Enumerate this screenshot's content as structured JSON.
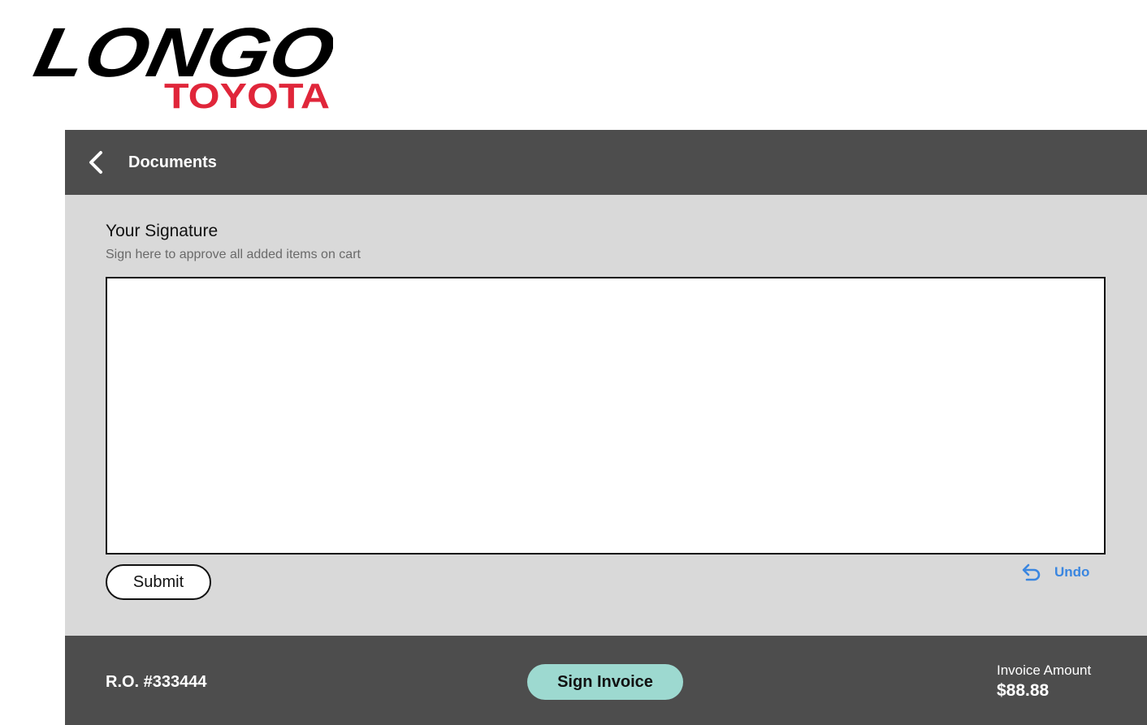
{
  "brand": {
    "logo_wordmark": "LONGO",
    "logo_subtitle": "TOYOTA",
    "wordmark_color": "#000000",
    "subtitle_color": "#e0263a"
  },
  "header": {
    "back_icon": "chevron-left-icon",
    "title": "Documents",
    "bg_color": "#4d4d4d"
  },
  "signature": {
    "title": "Your Signature",
    "subtitle": "Sign here to approve all added items on cart",
    "submit_label": "Submit",
    "undo_icon": "undo-arrow-icon",
    "undo_label": "Undo",
    "undo_color": "#3a86e0"
  },
  "footer": {
    "ro_number": "R.O. #333444",
    "sign_button_label": "Sign Invoice",
    "sign_button_color": "#9dd9d0",
    "invoice_label": "Invoice Amount",
    "invoice_amount": "$88.88"
  }
}
